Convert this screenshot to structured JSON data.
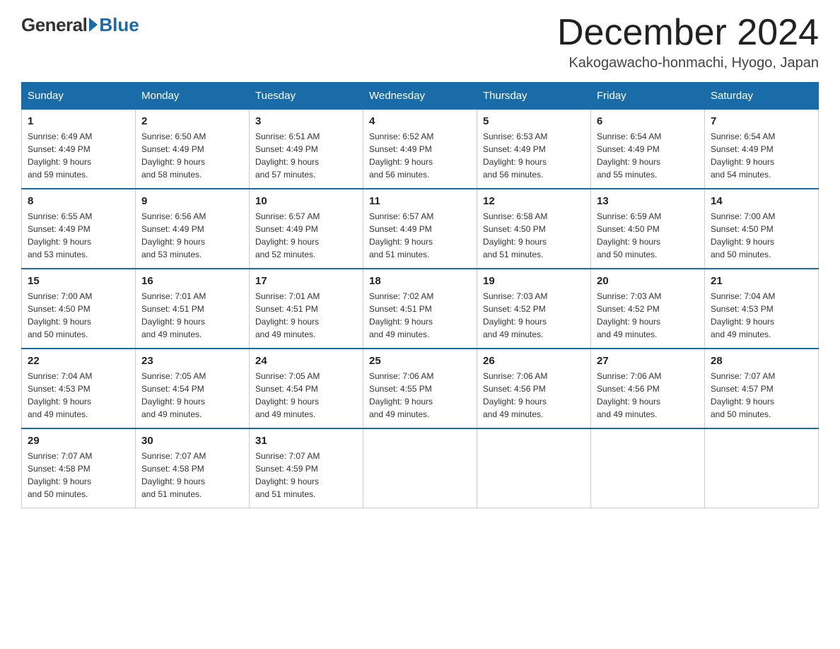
{
  "logo": {
    "general": "General",
    "blue": "Blue"
  },
  "header": {
    "month_title": "December 2024",
    "location": "Kakogawacho-honmachi, Hyogo, Japan"
  },
  "days_of_week": [
    "Sunday",
    "Monday",
    "Tuesday",
    "Wednesday",
    "Thursday",
    "Friday",
    "Saturday"
  ],
  "weeks": [
    [
      {
        "day": "1",
        "sunrise": "6:49 AM",
        "sunset": "4:49 PM",
        "daylight": "9 hours and 59 minutes."
      },
      {
        "day": "2",
        "sunrise": "6:50 AM",
        "sunset": "4:49 PM",
        "daylight": "9 hours and 58 minutes."
      },
      {
        "day": "3",
        "sunrise": "6:51 AM",
        "sunset": "4:49 PM",
        "daylight": "9 hours and 57 minutes."
      },
      {
        "day": "4",
        "sunrise": "6:52 AM",
        "sunset": "4:49 PM",
        "daylight": "9 hours and 56 minutes."
      },
      {
        "day": "5",
        "sunrise": "6:53 AM",
        "sunset": "4:49 PM",
        "daylight": "9 hours and 56 minutes."
      },
      {
        "day": "6",
        "sunrise": "6:54 AM",
        "sunset": "4:49 PM",
        "daylight": "9 hours and 55 minutes."
      },
      {
        "day": "7",
        "sunrise": "6:54 AM",
        "sunset": "4:49 PM",
        "daylight": "9 hours and 54 minutes."
      }
    ],
    [
      {
        "day": "8",
        "sunrise": "6:55 AM",
        "sunset": "4:49 PM",
        "daylight": "9 hours and 53 minutes."
      },
      {
        "day": "9",
        "sunrise": "6:56 AM",
        "sunset": "4:49 PM",
        "daylight": "9 hours and 53 minutes."
      },
      {
        "day": "10",
        "sunrise": "6:57 AM",
        "sunset": "4:49 PM",
        "daylight": "9 hours and 52 minutes."
      },
      {
        "day": "11",
        "sunrise": "6:57 AM",
        "sunset": "4:49 PM",
        "daylight": "9 hours and 51 minutes."
      },
      {
        "day": "12",
        "sunrise": "6:58 AM",
        "sunset": "4:50 PM",
        "daylight": "9 hours and 51 minutes."
      },
      {
        "day": "13",
        "sunrise": "6:59 AM",
        "sunset": "4:50 PM",
        "daylight": "9 hours and 50 minutes."
      },
      {
        "day": "14",
        "sunrise": "7:00 AM",
        "sunset": "4:50 PM",
        "daylight": "9 hours and 50 minutes."
      }
    ],
    [
      {
        "day": "15",
        "sunrise": "7:00 AM",
        "sunset": "4:50 PM",
        "daylight": "9 hours and 50 minutes."
      },
      {
        "day": "16",
        "sunrise": "7:01 AM",
        "sunset": "4:51 PM",
        "daylight": "9 hours and 49 minutes."
      },
      {
        "day": "17",
        "sunrise": "7:01 AM",
        "sunset": "4:51 PM",
        "daylight": "9 hours and 49 minutes."
      },
      {
        "day": "18",
        "sunrise": "7:02 AM",
        "sunset": "4:51 PM",
        "daylight": "9 hours and 49 minutes."
      },
      {
        "day": "19",
        "sunrise": "7:03 AM",
        "sunset": "4:52 PM",
        "daylight": "9 hours and 49 minutes."
      },
      {
        "day": "20",
        "sunrise": "7:03 AM",
        "sunset": "4:52 PM",
        "daylight": "9 hours and 49 minutes."
      },
      {
        "day": "21",
        "sunrise": "7:04 AM",
        "sunset": "4:53 PM",
        "daylight": "9 hours and 49 minutes."
      }
    ],
    [
      {
        "day": "22",
        "sunrise": "7:04 AM",
        "sunset": "4:53 PM",
        "daylight": "9 hours and 49 minutes."
      },
      {
        "day": "23",
        "sunrise": "7:05 AM",
        "sunset": "4:54 PM",
        "daylight": "9 hours and 49 minutes."
      },
      {
        "day": "24",
        "sunrise": "7:05 AM",
        "sunset": "4:54 PM",
        "daylight": "9 hours and 49 minutes."
      },
      {
        "day": "25",
        "sunrise": "7:06 AM",
        "sunset": "4:55 PM",
        "daylight": "9 hours and 49 minutes."
      },
      {
        "day": "26",
        "sunrise": "7:06 AM",
        "sunset": "4:56 PM",
        "daylight": "9 hours and 49 minutes."
      },
      {
        "day": "27",
        "sunrise": "7:06 AM",
        "sunset": "4:56 PM",
        "daylight": "9 hours and 49 minutes."
      },
      {
        "day": "28",
        "sunrise": "7:07 AM",
        "sunset": "4:57 PM",
        "daylight": "9 hours and 50 minutes."
      }
    ],
    [
      {
        "day": "29",
        "sunrise": "7:07 AM",
        "sunset": "4:58 PM",
        "daylight": "9 hours and 50 minutes."
      },
      {
        "day": "30",
        "sunrise": "7:07 AM",
        "sunset": "4:58 PM",
        "daylight": "9 hours and 51 minutes."
      },
      {
        "day": "31",
        "sunrise": "7:07 AM",
        "sunset": "4:59 PM",
        "daylight": "9 hours and 51 minutes."
      },
      null,
      null,
      null,
      null
    ]
  ],
  "labels": {
    "sunrise": "Sunrise:",
    "sunset": "Sunset:",
    "daylight": "Daylight:"
  }
}
